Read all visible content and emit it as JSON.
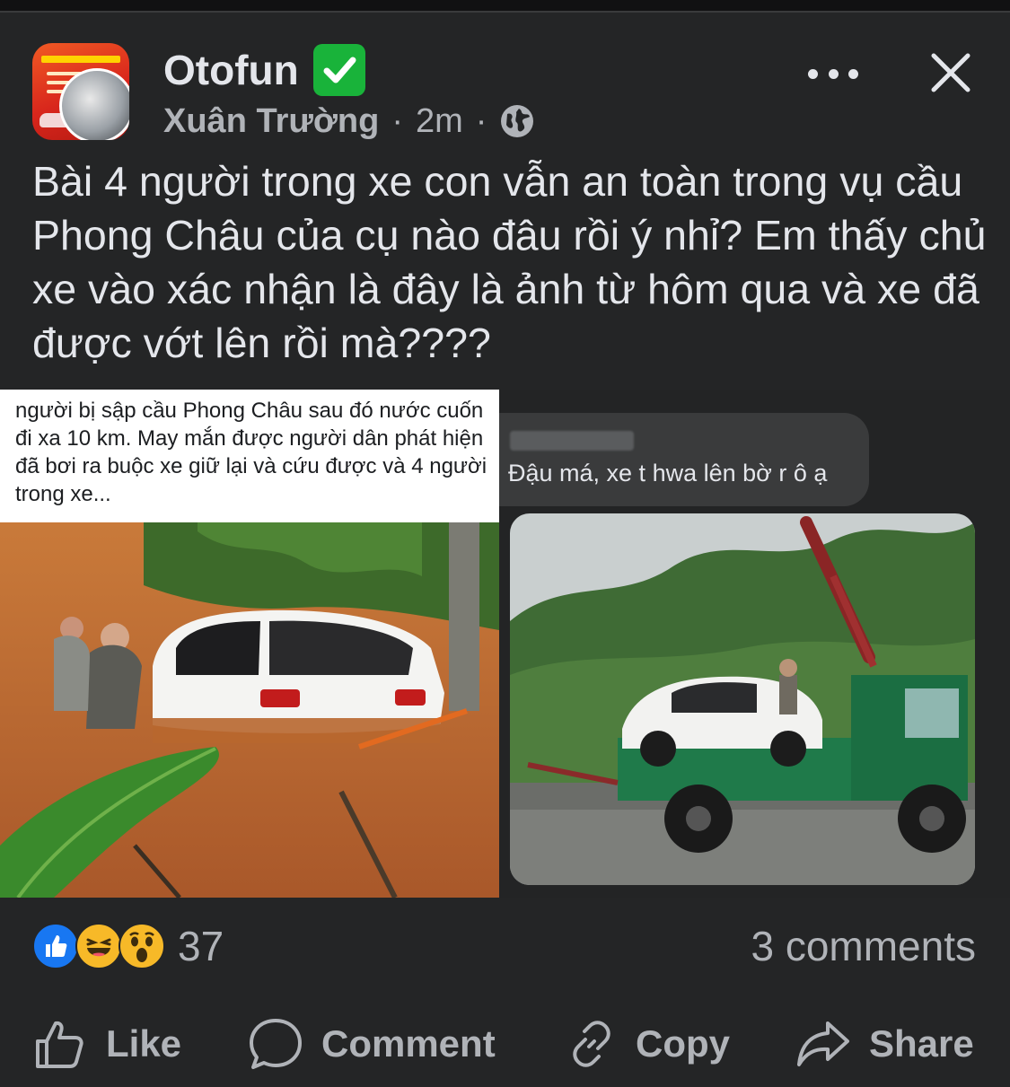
{
  "post": {
    "page_name": "Otofun",
    "author": "Xuân Trường",
    "separator": "·",
    "time": "2m",
    "text": "Bài 4 người trong xe con vẫn an toàn trong vụ cầu Phong Châu của cụ nào đâu rồi ý nhỉ? Em thấy chủ xe vào xác nhận là đây là ảnh từ hôm qua và xe đã được vớt lên rồi mà????"
  },
  "images": {
    "left_caption": "người bị sập cầu Phong Châu sau đó nước cuốn đi xa 10 km. May mắn được người dân phát hiện đã bơi ra buộc xe giữ lại và cứu được và 4 người trong xe...",
    "right_message": "Đậu má, xe t hwa lên bờ r ô ạ"
  },
  "stats": {
    "reaction_count": "37",
    "comments_label": "3 comments"
  },
  "actions": {
    "like": "Like",
    "comment": "Comment",
    "copy": "Copy",
    "share": "Share"
  },
  "icons": [
    "verified-check-icon",
    "globe-icon",
    "more-options-icon",
    "close-icon",
    "like-reaction-icon",
    "haha-reaction-icon",
    "wow-reaction-icon",
    "thumbs-up-icon",
    "comment-bubble-icon",
    "link-icon",
    "share-arrow-icon"
  ],
  "colors": {
    "background": "#242526",
    "text": "#e4e6eb",
    "secondary_text": "#b0b3b8",
    "verified": "#19b33a",
    "like_blue": "#1877f2",
    "reaction_yellow": "#f7b928"
  }
}
